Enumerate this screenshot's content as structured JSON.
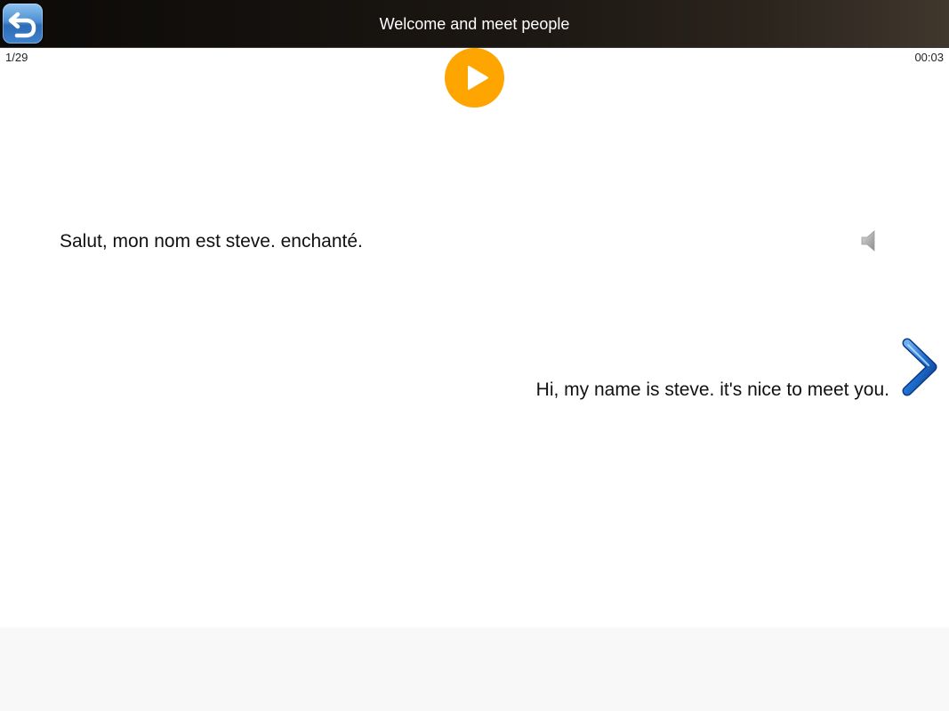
{
  "header": {
    "title": "Welcome and meet people",
    "back_icon": "back-arrow-icon",
    "bar_color_start": "#0c0a08",
    "bar_color_end": "#40372d"
  },
  "status": {
    "counter": "1/29",
    "timer": "00:03"
  },
  "player": {
    "play_icon": "play-icon",
    "accent_color": "#ffa500"
  },
  "phrase": {
    "source": "Salut, mon nom est steve. enchanté.",
    "translation": "Hi, my name is steve. it's nice to meet you.",
    "speaker_icon": "speaker-icon",
    "next_icon": "chevron-right-icon"
  }
}
